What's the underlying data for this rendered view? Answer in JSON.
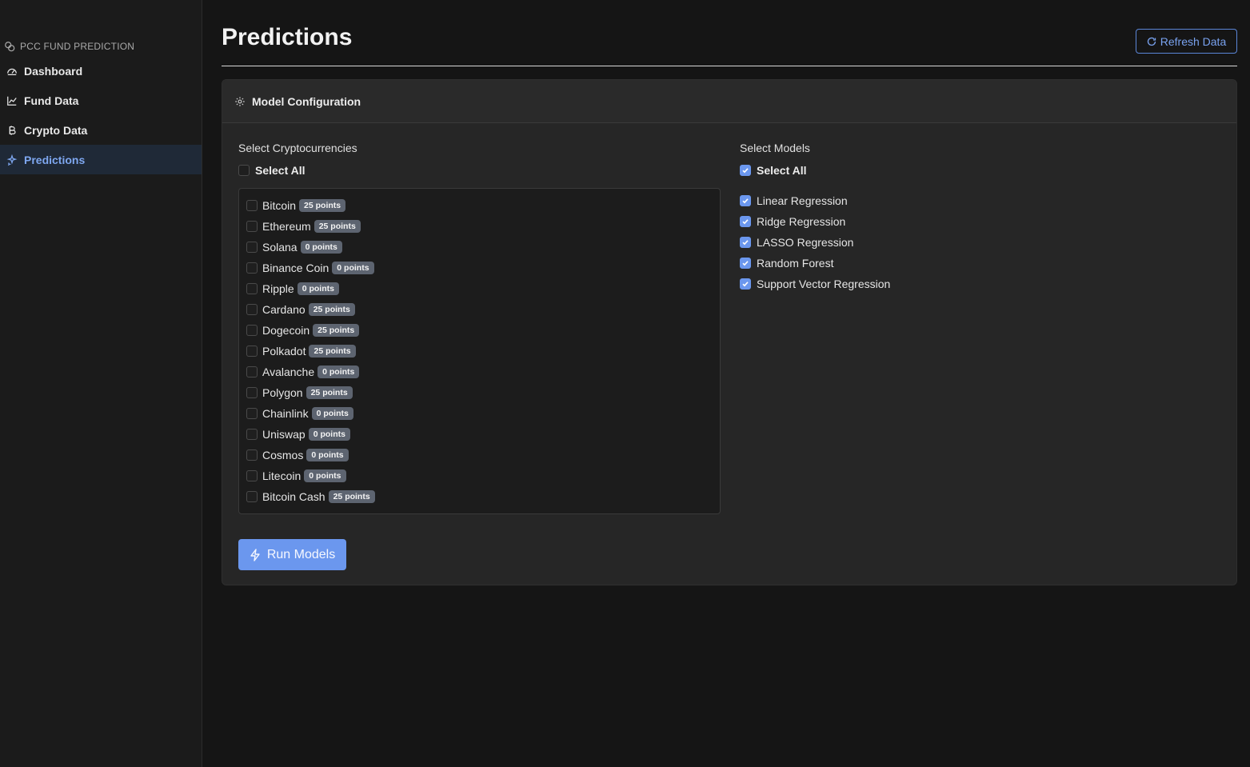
{
  "sidebar": {
    "brand": "PCC FUND PREDICTION",
    "items": [
      {
        "label": "Dashboard",
        "icon": "gauge-icon"
      },
      {
        "label": "Fund Data",
        "icon": "line-chart-icon"
      },
      {
        "label": "Crypto Data",
        "icon": "bitcoin-icon"
      },
      {
        "label": "Predictions",
        "icon": "sparkles-icon",
        "active": true
      }
    ]
  },
  "header": {
    "title": "Predictions",
    "refresh_label": "Refresh Data"
  },
  "config": {
    "title": "Model Configuration",
    "crypto_label": "Select Cryptocurrencies",
    "crypto_select_all": "Select All",
    "models_label": "Select Models",
    "models_select_all": "Select All",
    "cryptos": [
      {
        "name": "Bitcoin",
        "points": "25 points"
      },
      {
        "name": "Ethereum",
        "points": "25 points"
      },
      {
        "name": "Solana",
        "points": "0 points"
      },
      {
        "name": "Binance Coin",
        "points": "0 points"
      },
      {
        "name": "Ripple",
        "points": "0 points"
      },
      {
        "name": "Cardano",
        "points": "25 points"
      },
      {
        "name": "Dogecoin",
        "points": "25 points"
      },
      {
        "name": "Polkadot",
        "points": "25 points"
      },
      {
        "name": "Avalanche",
        "points": "0 points"
      },
      {
        "name": "Polygon",
        "points": "25 points"
      },
      {
        "name": "Chainlink",
        "points": "0 points"
      },
      {
        "name": "Uniswap",
        "points": "0 points"
      },
      {
        "name": "Cosmos",
        "points": "0 points"
      },
      {
        "name": "Litecoin",
        "points": "0 points"
      },
      {
        "name": "Bitcoin Cash",
        "points": "25 points"
      }
    ],
    "models": [
      {
        "name": "Linear Regression",
        "checked": true
      },
      {
        "name": "Ridge Regression",
        "checked": true
      },
      {
        "name": "LASSO Regression",
        "checked": true
      },
      {
        "name": "Random Forest",
        "checked": true
      },
      {
        "name": "Support Vector Regression",
        "checked": true
      }
    ],
    "run_label": "Run Models"
  },
  "colors": {
    "accent": "#6b97ee",
    "background": "#151515",
    "card": "#262626",
    "badge": "#5d6470"
  }
}
